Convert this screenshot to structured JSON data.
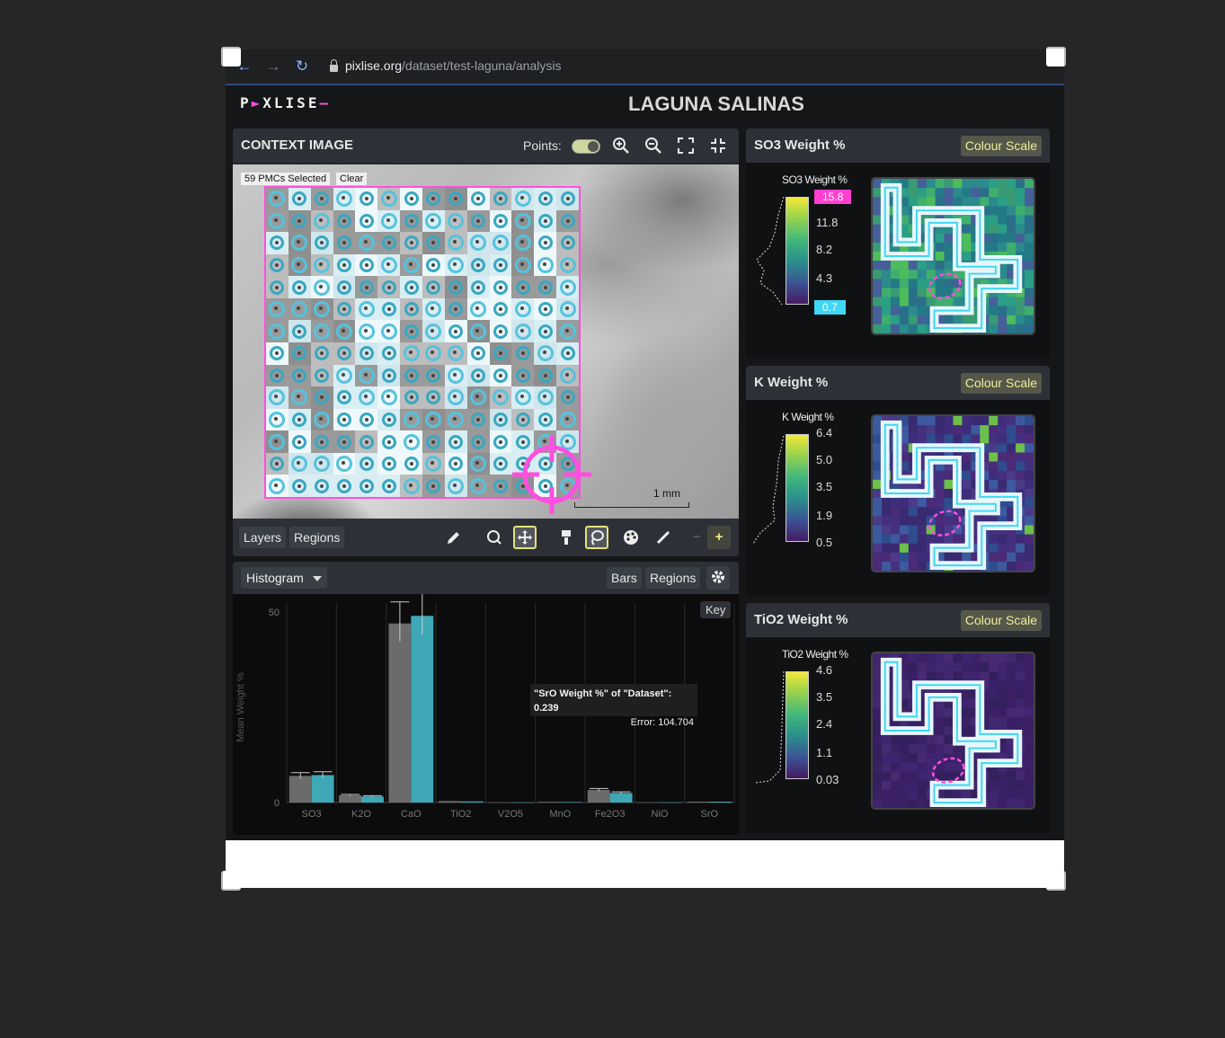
{
  "browser": {
    "url_host": "pixlise.org",
    "url_path": "/dataset/test-laguna/analysis",
    "back_icon": "arrow-left-icon",
    "forward_icon": "arrow-right-icon",
    "reload_icon": "reload-icon"
  },
  "app": {
    "logo": "PIXLISE",
    "dataset_title": "LAGUNA SALINAS"
  },
  "context_image": {
    "title": "CONTEXT IMAGE",
    "points_label": "Points:",
    "points_on": true,
    "pmc_selected": "59 PMCs Selected",
    "clear_label": "Clear",
    "scale_label": "1 mm",
    "layers_label": "Layers",
    "regions_label": "Regions"
  },
  "histogram": {
    "selector_label": "Histogram",
    "bars_label": "Bars",
    "regions_label": "Regions",
    "key_label": "Key",
    "tooltip_line1": "\"SrO Weight %\" of \"Dataset\": 0.239",
    "tooltip_line2": "Error: 104.704",
    "colors": {
      "dataset": "#6b6b6b",
      "selection": "#3fa8b6"
    },
    "chart_data": {
      "type": "bar",
      "categories": [
        "SO3",
        "K2O",
        "CaO",
        "TiO2",
        "V2O5",
        "MnO",
        "Fe2O3",
        "NiO",
        "SrO"
      ],
      "series": [
        {
          "values": [
            7,
            1.9,
            47,
            0.4,
            0.05,
            0.2,
            3.3,
            0.05,
            0.24
          ]
        },
        {
          "values": [
            7.2,
            1.6,
            49,
            0.3,
            0.05,
            0.15,
            2.5,
            0.05,
            0.24
          ]
        }
      ],
      "ylabel": "Mean Weight %",
      "yticks": [
        0,
        50
      ],
      "ylim": [
        0,
        50
      ]
    }
  },
  "maps": [
    {
      "title": "SO3 Weight %",
      "colour_scale_label": "Colour Scale",
      "scale_title": "SO3 Weight %",
      "max": "15.8",
      "ticks": [
        "11.8",
        "8.2",
        "4.3"
      ],
      "min": "0.7"
    },
    {
      "title": "K Weight %",
      "colour_scale_label": "Colour Scale",
      "scale_title": "K Weight %",
      "max": "6.4",
      "ticks": [
        "5.0",
        "3.5",
        "1.9"
      ],
      "min": "0.5"
    },
    {
      "title": "TiO2 Weight %",
      "colour_scale_label": "Colour Scale",
      "scale_title": "TiO2 Weight %",
      "max": "4.6",
      "ticks": [
        "3.5",
        "2.4",
        "1.1"
      ],
      "min": "0.03"
    }
  ],
  "colors": {
    "selection_magenta": "#ff4fe0",
    "selection_cyan": "#3fd7f5",
    "button_accent": "#efef9a"
  }
}
